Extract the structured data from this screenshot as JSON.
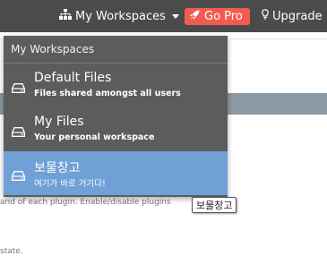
{
  "topbar": {
    "workspaces_label": "My Workspaces",
    "gopro_label": "Go Pro",
    "upgrade_label": "Upgrade"
  },
  "page": {
    "text_line_1": "and of each plugin. Enable/disable plugins",
    "text_line_2": "state."
  },
  "dropdown": {
    "header": "My Workspaces",
    "items": [
      {
        "title": "Default Files",
        "subtitle": "Files shared amongst all users",
        "icon": "drive-icon"
      },
      {
        "title": "My Files",
        "subtitle": "Your personal workspace",
        "icon": "drive-icon"
      },
      {
        "title": "보물창고",
        "subtitle": "여기가 바로 거기다!",
        "icon": "drive-icon"
      }
    ]
  },
  "tooltip": {
    "text": "보물창고"
  },
  "colors": {
    "topbar": "#4b4b4b",
    "dropdown": "#5c5c5c",
    "active_item": "#6fa0d6",
    "gopro": "#f25b4f"
  }
}
